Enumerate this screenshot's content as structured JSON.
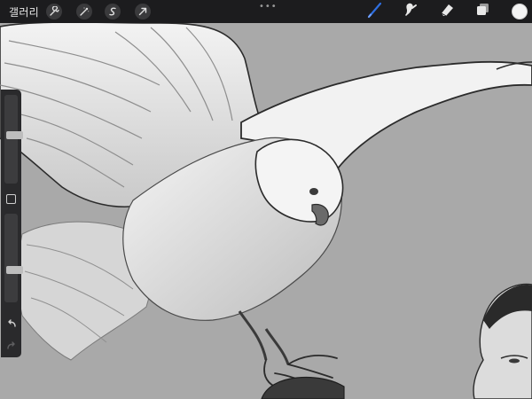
{
  "app": {
    "gallery_label": "갤러리"
  },
  "toolbar": {
    "left_tools": [
      "wrench-icon",
      "magic-wand-icon",
      "selection-icon",
      "transform-icon"
    ],
    "more_label": "•••",
    "right_tools": [
      "brush-icon",
      "smudge-icon",
      "eraser-icon",
      "layers-icon"
    ],
    "active_tool": "brush-icon",
    "active_color": "#f4f4f4",
    "accent_color": "#2f6fe0"
  },
  "sidebar": {
    "brush_size_level": 0.55,
    "opacity_level": 0.35,
    "undo_icon": "undo-icon",
    "redo_icon": "redo-icon"
  },
  "canvas": {
    "background_color": "#a9a9a9"
  }
}
